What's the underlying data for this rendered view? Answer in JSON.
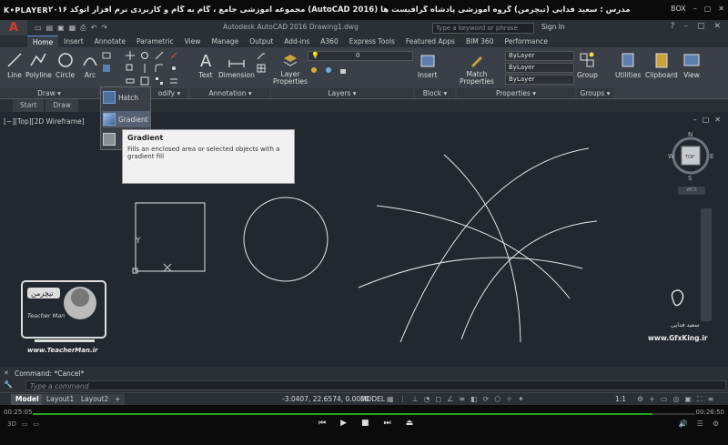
{
  "player": {
    "logo": "K•PLAYER",
    "title": "مجموعه آموزشی جامع ، گام به گام و کاربردی نرم افزار اتوکد ۲۰۱۶ (AutoCAD 2016)  مدرس : سعید فدایی (تیچرمن) گروه آموزشی پادشاه گرافیست ها",
    "box_label": "BOX",
    "time_current": "00:25:05",
    "time_total": "00:26:50",
    "progress": 0.935
  },
  "acad": {
    "app_logo": "A",
    "doc_title": "Autodesk AutoCAD 2016   Drawing1.dwg",
    "search_placeholder": "Type a keyword or phrase",
    "signin": "Sign In",
    "tabs": [
      "Home",
      "Insert",
      "Annotate",
      "Parametric",
      "View",
      "Manage",
      "Output",
      "Add-ins",
      "A360",
      "Express Tools",
      "Featured Apps",
      "BIM 360",
      "Performance"
    ],
    "active_tab": "Home",
    "tools": {
      "line": "Line",
      "polyline": "Polyline",
      "circle": "Circle",
      "arc": "Arc",
      "text": "Text",
      "dimension": "Dimension",
      "layer_properties": "Layer Properties",
      "insert": "Insert",
      "match_properties": "Match Properties",
      "group": "Group",
      "utilities": "Utilities",
      "clipboard": "Clipboard",
      "view": "View"
    },
    "panels": {
      "draw": "Draw",
      "modify": "odify",
      "annotation": "Annotation",
      "layers": "Layers",
      "block": "Block",
      "properties": "Properties",
      "groups": "Groups"
    },
    "layer_value": "0",
    "bylayer_1": "ByLayer",
    "bylayer_2": "ByLayer",
    "bylayer_3": "ByLayer",
    "file_tabs": [
      "Start",
      "Draw"
    ],
    "flyout": {
      "hatch": "Hatch",
      "gradient": "Gradient"
    },
    "tooltip": {
      "title": "Gradient",
      "desc": "Fills an enclosed area or selected objects with a gradient fill"
    },
    "viewport_label": "[−][Top][2D Wireframe]",
    "viewcube": {
      "top": "TOP",
      "n": "N",
      "s": "S",
      "e": "E",
      "w": "W",
      "wcs": "WCS"
    },
    "ucs_y": "Y",
    "watermark_left": "www.TeacherMan.ir",
    "watermark_right": "www.GfxKing.ir",
    "watermark_name": "سعید فدایی",
    "watermark_badge": "تیچرمن",
    "watermark_sub": "Teacher Man",
    "command_history": "Command: *Cancel*",
    "command_placeholder": "Type a command",
    "layout_tabs": [
      "Model",
      "Layout1",
      "Layout2"
    ],
    "layout_add": "+",
    "coords": "-3.0407, 22.6574, 0.0000",
    "model_label": "MODEL",
    "scale": "1:1"
  }
}
